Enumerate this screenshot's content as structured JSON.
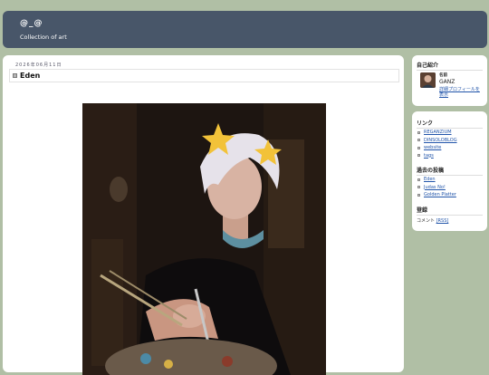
{
  "header": {
    "title": "@_@",
    "description": "Collection of art"
  },
  "post": {
    "date": "2026年06月11日",
    "title": "Eden",
    "image_alt": "Painting of a white-haired young man with star ornaments holding paintbrushes and a palette"
  },
  "sidebar": {
    "profile": {
      "heading": "自己紹介",
      "name_label": "名前",
      "name": "GANZ",
      "full_profile_link": "詳細プロフィールを表示"
    },
    "links": {
      "heading": "リンク",
      "items": [
        "REGANZIUM",
        "DINSOLOBLOG",
        "website",
        "tags"
      ]
    },
    "archive": {
      "heading": "過去の投稿",
      "items": [
        "Eden",
        "Judas No!",
        "Golden Platter"
      ]
    },
    "register": {
      "heading": "登録",
      "comment_label": "コメント",
      "rss_label": "[RSS]"
    }
  },
  "colors": {
    "page_bg": "#b0bfa5",
    "header_bg": "#485669",
    "link": "#2255aa"
  }
}
